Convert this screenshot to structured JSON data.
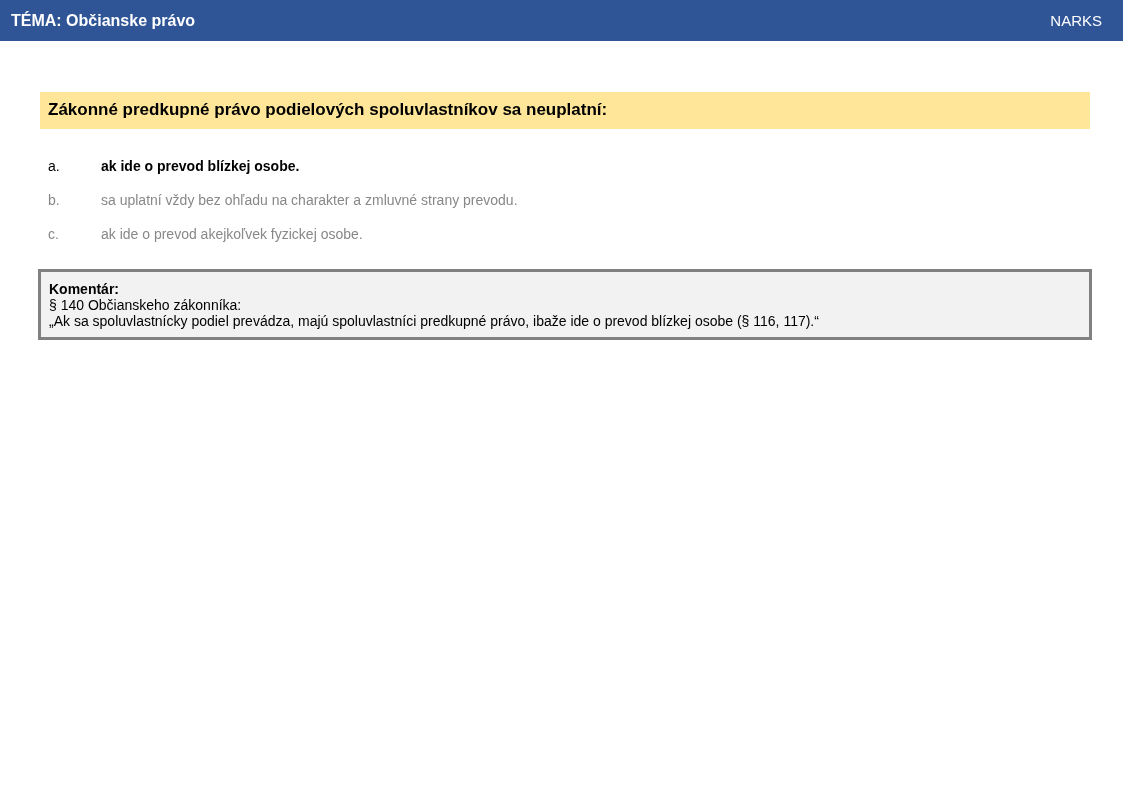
{
  "header": {
    "title": "TÉMA: Občianske právo",
    "brand": "NARKS"
  },
  "question": "Zákonné predkupné právo podielových spoluvlastníkov sa neuplatní:",
  "options": [
    {
      "letter": "a.",
      "text": "ak ide o prevod blízkej osobe.",
      "selected": true
    },
    {
      "letter": "b.",
      "text": "sa uplatní vždy bez ohľadu na charakter a zmluvné strany prevodu.",
      "selected": false
    },
    {
      "letter": "c.",
      "text": "ak ide o prevod akejkoľvek fyzickej osobe.",
      "selected": false
    }
  ],
  "comment": {
    "title": "Komentár:",
    "lines": [
      "§ 140 Občianskeho zákonníka:",
      "„Ak sa spoluvlastnícky podiel prevádza, majú spoluvlastníci predkupné právo, ibaže ide o prevod blízkej osobe (§ 116, 117).“"
    ]
  }
}
